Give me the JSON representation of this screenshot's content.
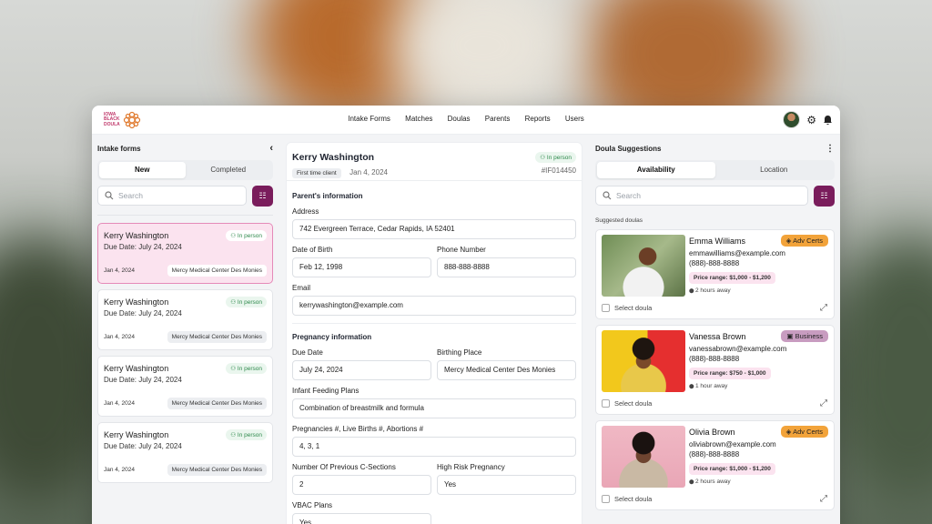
{
  "logo": {
    "text": "IOWA BLACK DOULA"
  },
  "nav": [
    "Intake Forms",
    "Matches",
    "Doulas",
    "Parents",
    "Reports",
    "Users"
  ],
  "left": {
    "title": "Intake forms",
    "tabs": [
      "New",
      "Completed"
    ],
    "search_placeholder": "Search",
    "cards": [
      {
        "name": "Kerry Washington",
        "due": "Due Date: July 24, 2024",
        "mode": "In person",
        "date": "Jan 4, 2024",
        "hospital": "Mercy Medical Center Des Monies"
      },
      {
        "name": "Kerry Washington",
        "due": "Due Date: July 24, 2024",
        "mode": "In person",
        "date": "Jan 4, 2024",
        "hospital": "Mercy Medical Center Des Monies"
      },
      {
        "name": "Kerry Washington",
        "due": "Due Date: July 24, 2024",
        "mode": "In person",
        "date": "Jan 4, 2024",
        "hospital": "Mercy Medical Center Des Monies"
      },
      {
        "name": "Kerry Washington",
        "due": "Due Date: July 24, 2024",
        "mode": "In person",
        "date": "Jan 4, 2024",
        "hospital": "Mercy Medical Center Des Monies"
      }
    ]
  },
  "middle": {
    "name": "Kerry Washington",
    "tag": "First time client",
    "date": "Jan 4, 2024",
    "mode": "In person",
    "id": "#IF014450",
    "parent_section": "Parent's information",
    "address_label": "Address",
    "address": "742 Evergreen Terrace, Cedar Rapids, IA 52401",
    "dob_label": "Date of Birth",
    "dob": "Feb 12, 1998",
    "phone_label": "Phone Number",
    "phone": "888-888-8888",
    "email_label": "Email",
    "email": "kerrywashington@example.com",
    "preg_section": "Pregnancy information",
    "due_label": "Due Date",
    "due": "July 24, 2024",
    "birth_label": "Birthing Place",
    "birth": "Mercy Medical Center Des Monies",
    "feed_label": "Infant Feeding Plans",
    "feed": "Combination of breastmilk and formula",
    "preg_label": "Pregnancies #, Live Births #, Abortions #",
    "preg": "4, 3, 1",
    "csec_label": "Number Of Previous C-Sections",
    "csec": "2",
    "risk_label": "High Risk Pregnancy",
    "risk": "Yes",
    "vbac_label": "VBAC Plans",
    "vbac": "Yes"
  },
  "right": {
    "title": "Doula Suggestions",
    "tabs": [
      "Availability",
      "Location"
    ],
    "search_placeholder": "Search",
    "subtitle": "Suggested doulas",
    "select_label": "Select doula",
    "doulas": [
      {
        "name": "Emma Williams",
        "email": "emmawilliams@example.com",
        "phone": "(888)-888-8888",
        "price": "Price range: $1,000 - $1,200",
        "away": "2 hours away",
        "badge": "Adv Certs"
      },
      {
        "name": "Vanessa Brown",
        "email": "vanessabrown@example.com",
        "phone": "(888)-888-8888",
        "price": "Price range: $750 - $1,000",
        "away": "1 hour away",
        "badge": "Business"
      },
      {
        "name": "Olivia Brown",
        "email": "oliviabrown@example.com",
        "phone": "(888)-888-8888",
        "price": "Price range: $1,000 - $1,200",
        "away": "2 hours away",
        "badge": "Adv Certs"
      }
    ]
  },
  "colors": {
    "accent": "#7a1d5c",
    "selected_card": "#fbe3ef",
    "green": "#2f8a4d",
    "cert_badge": "#f2a33a",
    "business_badge": "#c89cc0"
  }
}
